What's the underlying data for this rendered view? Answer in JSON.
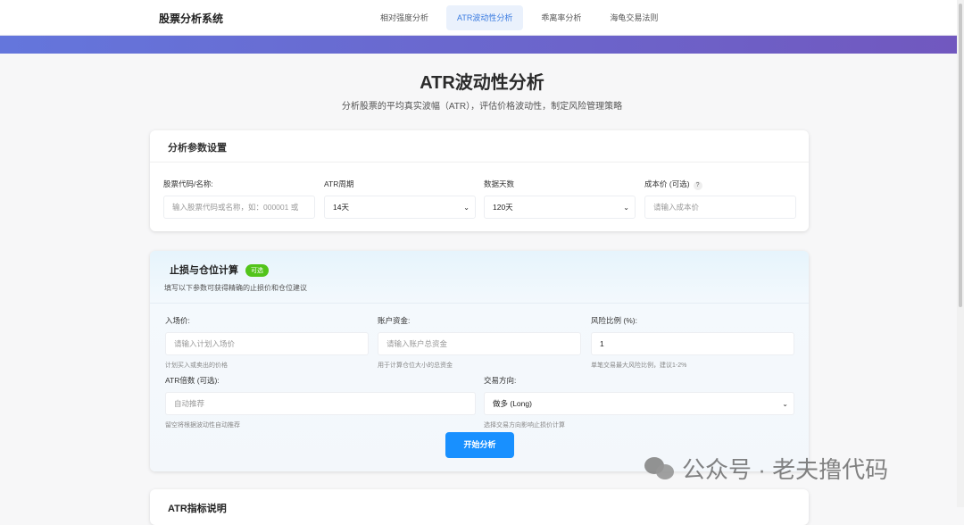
{
  "header": {
    "brand": "股票分析系统",
    "nav": [
      "相对强度分析",
      "ATR波动性分析",
      "乖离率分析",
      "海龟交易法则"
    ],
    "active": 1
  },
  "page": {
    "title": "ATR波动性分析",
    "subtitle": "分析股票的平均真实波幅（ATR），评估价格波动性，制定风险管理策略"
  },
  "params": {
    "title": "分析参数设置",
    "stock": {
      "label": "股票代码/名称:",
      "placeholder": "输入股票代码或名称，如：000001 或"
    },
    "period": {
      "label": "ATR周期",
      "value": "14天"
    },
    "days": {
      "label": "数据天数",
      "value": "120天"
    },
    "cost": {
      "label": "成本价 (可选)",
      "help_icon": "?",
      "placeholder": "请输入成本价"
    }
  },
  "stoploss": {
    "title": "止损与仓位计算",
    "badge": "可选",
    "desc": "填写以下参数可获得精确的止损价和仓位建议",
    "entry": {
      "label": "入场价:",
      "placeholder": "请输入计划入场价",
      "help": "计划买入或卖出的价格"
    },
    "capital": {
      "label": "账户资金:",
      "placeholder": "请输入账户总资金",
      "help": "用于计算仓位大小的总资金"
    },
    "risk": {
      "label": "风险比例 (%):",
      "value": "1",
      "help": "单笔交易最大风险比例，建议1-2%"
    },
    "multiplier": {
      "label": "ATR倍数 (可选):",
      "placeholder": "自动推荐",
      "help": "留空将根据波动性自动推荐"
    },
    "direction": {
      "label": "交易方向:",
      "value": "做多 (Long)",
      "help": "选择交易方向影响止损价计算"
    },
    "submit": "开始分析"
  },
  "info": {
    "title": "ATR指标说明"
  },
  "watermark": "公众号 · 老夫撸代码"
}
